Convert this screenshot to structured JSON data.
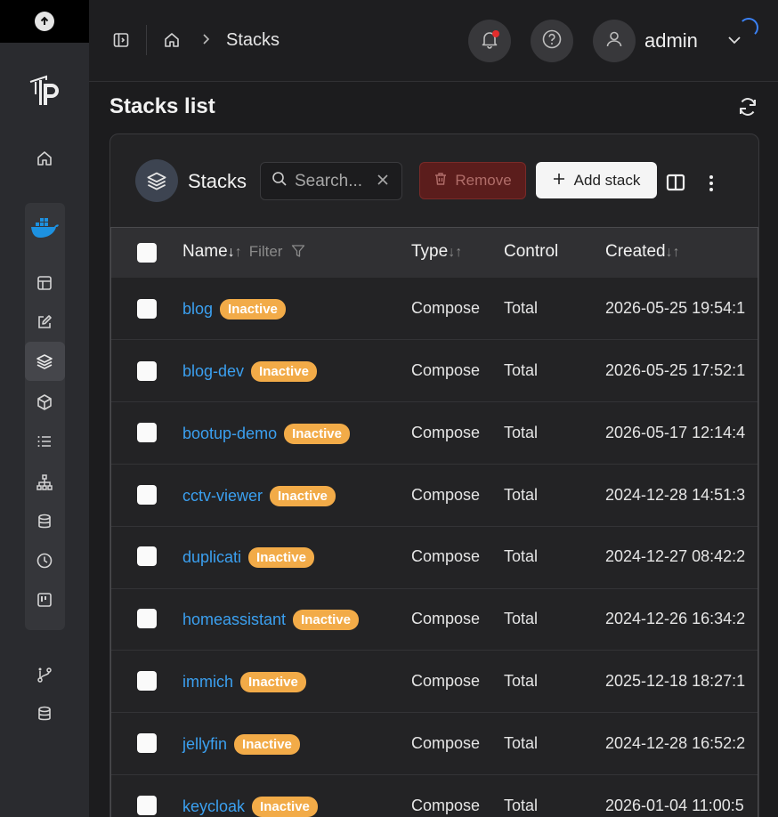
{
  "breadcrumb": {
    "current": "Stacks"
  },
  "user": {
    "name": "admin"
  },
  "page": {
    "title": "Stacks list"
  },
  "card": {
    "title": "Stacks",
    "search_placeholder": "Search...",
    "remove_label": "Remove",
    "add_label": "Add stack"
  },
  "table": {
    "headers": {
      "name": "Name",
      "filter": "Filter",
      "type": "Type",
      "control": "Control",
      "created": "Created"
    },
    "rows": [
      {
        "name": "blog",
        "status": "Inactive",
        "type": "Compose",
        "control": "Total",
        "created": "2026-05-25 19:54:1"
      },
      {
        "name": "blog-dev",
        "status": "Inactive",
        "type": "Compose",
        "control": "Total",
        "created": "2026-05-25 17:52:1"
      },
      {
        "name": "bootup-demo",
        "status": "Inactive",
        "type": "Compose",
        "control": "Total",
        "created": "2026-05-17 12:14:4"
      },
      {
        "name": "cctv-viewer",
        "status": "Inactive",
        "type": "Compose",
        "control": "Total",
        "created": "2024-12-28 14:51:3"
      },
      {
        "name": "duplicati",
        "status": "Inactive",
        "type": "Compose",
        "control": "Total",
        "created": "2024-12-27 08:42:2"
      },
      {
        "name": "homeassistant",
        "status": "Inactive",
        "type": "Compose",
        "control": "Total",
        "created": "2024-12-26 16:34:2"
      },
      {
        "name": "immich",
        "status": "Inactive",
        "type": "Compose",
        "control": "Total",
        "created": "2025-12-18 18:27:1"
      },
      {
        "name": "jellyfin",
        "status": "Inactive",
        "type": "Compose",
        "control": "Total",
        "created": "2024-12-28 16:52:2"
      },
      {
        "name": "keycloak",
        "status": "Inactive",
        "type": "Compose",
        "control": "Total",
        "created": "2026-01-04 11:00:5"
      }
    ]
  },
  "colors": {
    "accent_link": "#3ba0f0",
    "inactive_badge": "#f2ab48",
    "remove_bg": "#5b1d1c",
    "notification_dot": "#e42d2d"
  }
}
